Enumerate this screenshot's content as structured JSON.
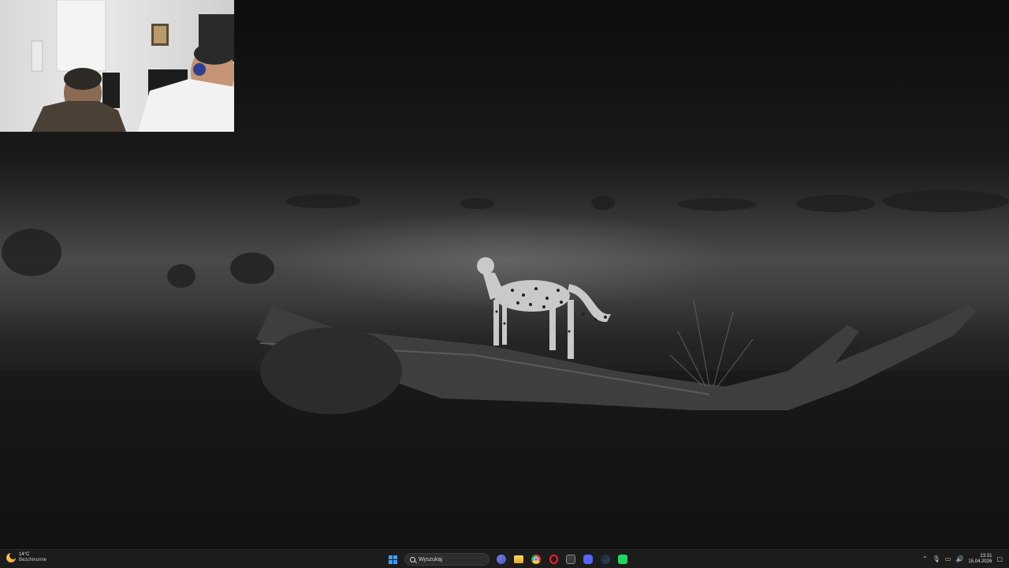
{
  "weather": {
    "temperature": "14°C",
    "condition": "Bezchmurnie",
    "icon": "moon-weather-icon"
  },
  "taskbar": {
    "search_placeholder": "Wyszukaj",
    "apps": [
      {
        "name": "start-icon"
      },
      {
        "name": "teams-icon"
      },
      {
        "name": "file-explorer-icon"
      },
      {
        "name": "chrome-icon"
      },
      {
        "name": "opera-icon"
      },
      {
        "name": "xbox-icon"
      },
      {
        "name": "discord-icon"
      },
      {
        "name": "steam-icon"
      },
      {
        "name": "app-icon"
      }
    ]
  },
  "tray": {
    "chevron": "⌃",
    "mic": "🎙",
    "network": "▭",
    "volume": "🔊",
    "time": "23:31",
    "date": "15.04.2026",
    "notifications": "▢"
  },
  "colors": {
    "accent": "#3aa0ff",
    "taskbar_bg": "#1c1c1c"
  }
}
